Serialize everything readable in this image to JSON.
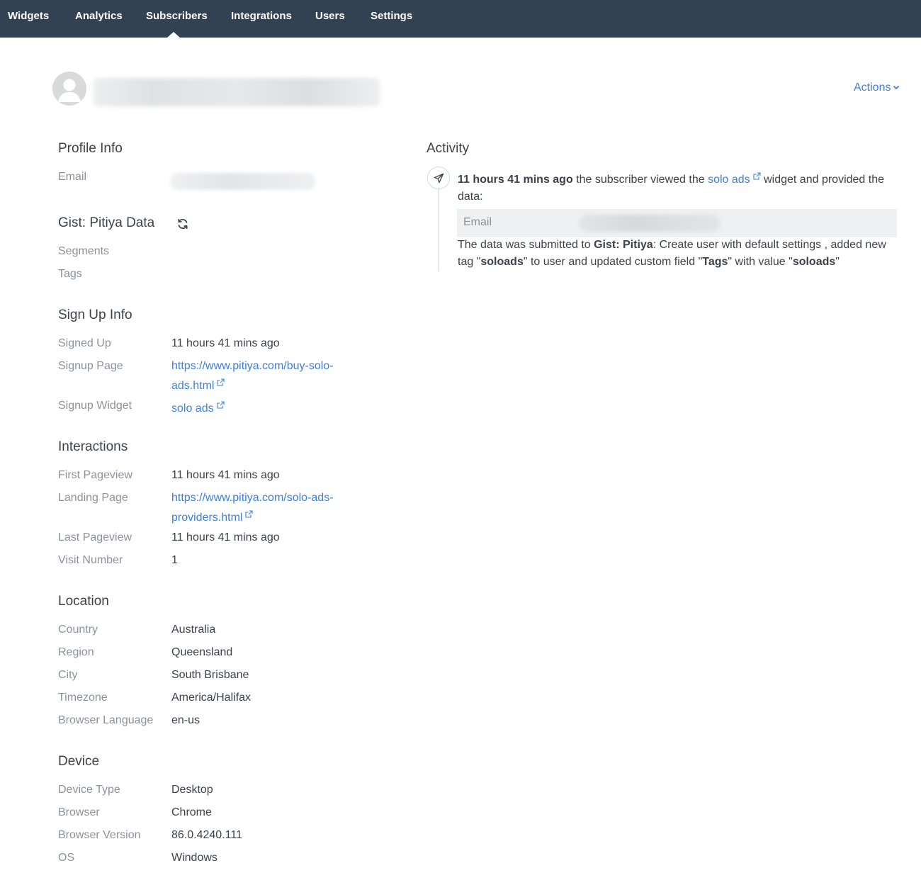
{
  "nav": {
    "items": [
      {
        "label": "Widgets"
      },
      {
        "label": "Analytics"
      },
      {
        "label": "Subscribers"
      },
      {
        "label": "Integrations"
      },
      {
        "label": "Users"
      },
      {
        "label": "Settings"
      }
    ],
    "active": "Subscribers"
  },
  "header": {
    "actions_label": "Actions",
    "avatar_icon": "user-avatar-icon"
  },
  "profile": {
    "title": "Profile Info",
    "email_label": "Email"
  },
  "gist": {
    "title": "Gist: Pitiya Data",
    "refresh_icon": "refresh-icon",
    "segments_label": "Segments",
    "tags_label": "Tags"
  },
  "signup": {
    "title": "Sign Up Info",
    "signed_up_label": "Signed Up",
    "signed_up_value": "11 hours 41 mins ago",
    "page_label": "Signup Page",
    "page_value": "https://www.pitiya.com/buy-solo-ads.html",
    "widget_label": "Signup Widget",
    "widget_value": "solo ads"
  },
  "interactions": {
    "title": "Interactions",
    "first_pageview_label": "First Pageview",
    "first_pageview_value": "11 hours 41 mins ago",
    "landing_page_label": "Landing Page",
    "landing_page_value": "https://www.pitiya.com/solo-ads-providers.html",
    "last_pageview_label": "Last Pageview",
    "last_pageview_value": "11 hours 41 mins ago",
    "visit_number_label": "Visit Number",
    "visit_number_value": "1"
  },
  "location": {
    "title": "Location",
    "country_label": "Country",
    "country_value": "Australia",
    "region_label": "Region",
    "region_value": "Queensland",
    "city_label": "City",
    "city_value": "South Brisbane",
    "timezone_label": "Timezone",
    "timezone_value": "America/Halifax",
    "language_label": "Browser Language",
    "language_value": "en-us"
  },
  "device": {
    "title": "Device",
    "type_label": "Device Type",
    "type_value": "Desktop",
    "browser_label": "Browser",
    "browser_value": "Chrome",
    "version_label": "Browser Version",
    "version_value": "86.0.4240.111",
    "os_label": "OS",
    "os_value": "Windows"
  },
  "activity": {
    "title": "Activity",
    "time": "11 hours 41 mins ago",
    "text_viewed": " the subscriber viewed the ",
    "widget_link": "solo ads",
    "text_provided": " widget and provided the data:",
    "email_label": "Email",
    "submitted_prefix": "The data was submitted to ",
    "integration": "Gist: Pitiya",
    "submitted_mid": ": Create user with default settings , added new tag \"",
    "tag": "soloads",
    "submitted_mid2": "\" to user and updated custom field \"",
    "field": "Tags",
    "submitted_mid3": "\" with value \"",
    "field_value": "soloads",
    "submitted_end": "\"",
    "icon": "paper-plane-icon"
  },
  "colors": {
    "nav_bg": "#334252",
    "link": "#3d7fd9",
    "label": "#8b9299",
    "text": "#3b4249"
  }
}
